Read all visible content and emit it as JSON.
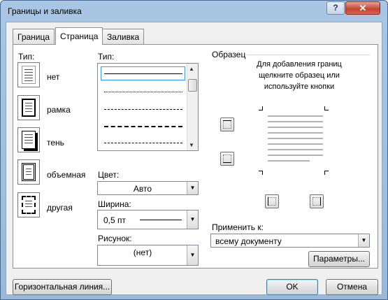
{
  "title": "Границы и заливка",
  "titlebar": {
    "help_label": "?",
    "close_label": "✕"
  },
  "tabs": [
    {
      "label": "Граница",
      "active": false
    },
    {
      "label": "Страница",
      "active": true
    },
    {
      "label": "Заливка",
      "active": false
    }
  ],
  "setting": {
    "label": "Тип:",
    "items": [
      {
        "label": "нет",
        "icon": "page-none-icon",
        "selected": true
      },
      {
        "label": "рамка",
        "icon": "page-box-icon"
      },
      {
        "label": "тень",
        "icon": "page-shadow-icon"
      },
      {
        "label": "объемная",
        "icon": "page-3d-icon"
      },
      {
        "label": "другая",
        "icon": "page-custom-icon"
      }
    ]
  },
  "style": {
    "label": "Тип:",
    "lines": [
      "solid",
      "dotted",
      "dashed-small",
      "dashed",
      "dash-dot"
    ],
    "selected_index": 0
  },
  "color": {
    "label": "Цвет:",
    "value": "Авто"
  },
  "width": {
    "label": "Ширина:",
    "value": "0,5 пт"
  },
  "art": {
    "label": "Рисунок:",
    "value": "(нет)"
  },
  "preview": {
    "label": "Образец",
    "hint": "Для добавления границ щелкните образец или используйте кнопки"
  },
  "apply_to": {
    "label": "Применить к:",
    "value": "всему документу"
  },
  "buttons": {
    "options": "Параметры...",
    "horizontal_line": "Горизонтальная линия...",
    "ok": "OK",
    "cancel": "Отмена"
  }
}
